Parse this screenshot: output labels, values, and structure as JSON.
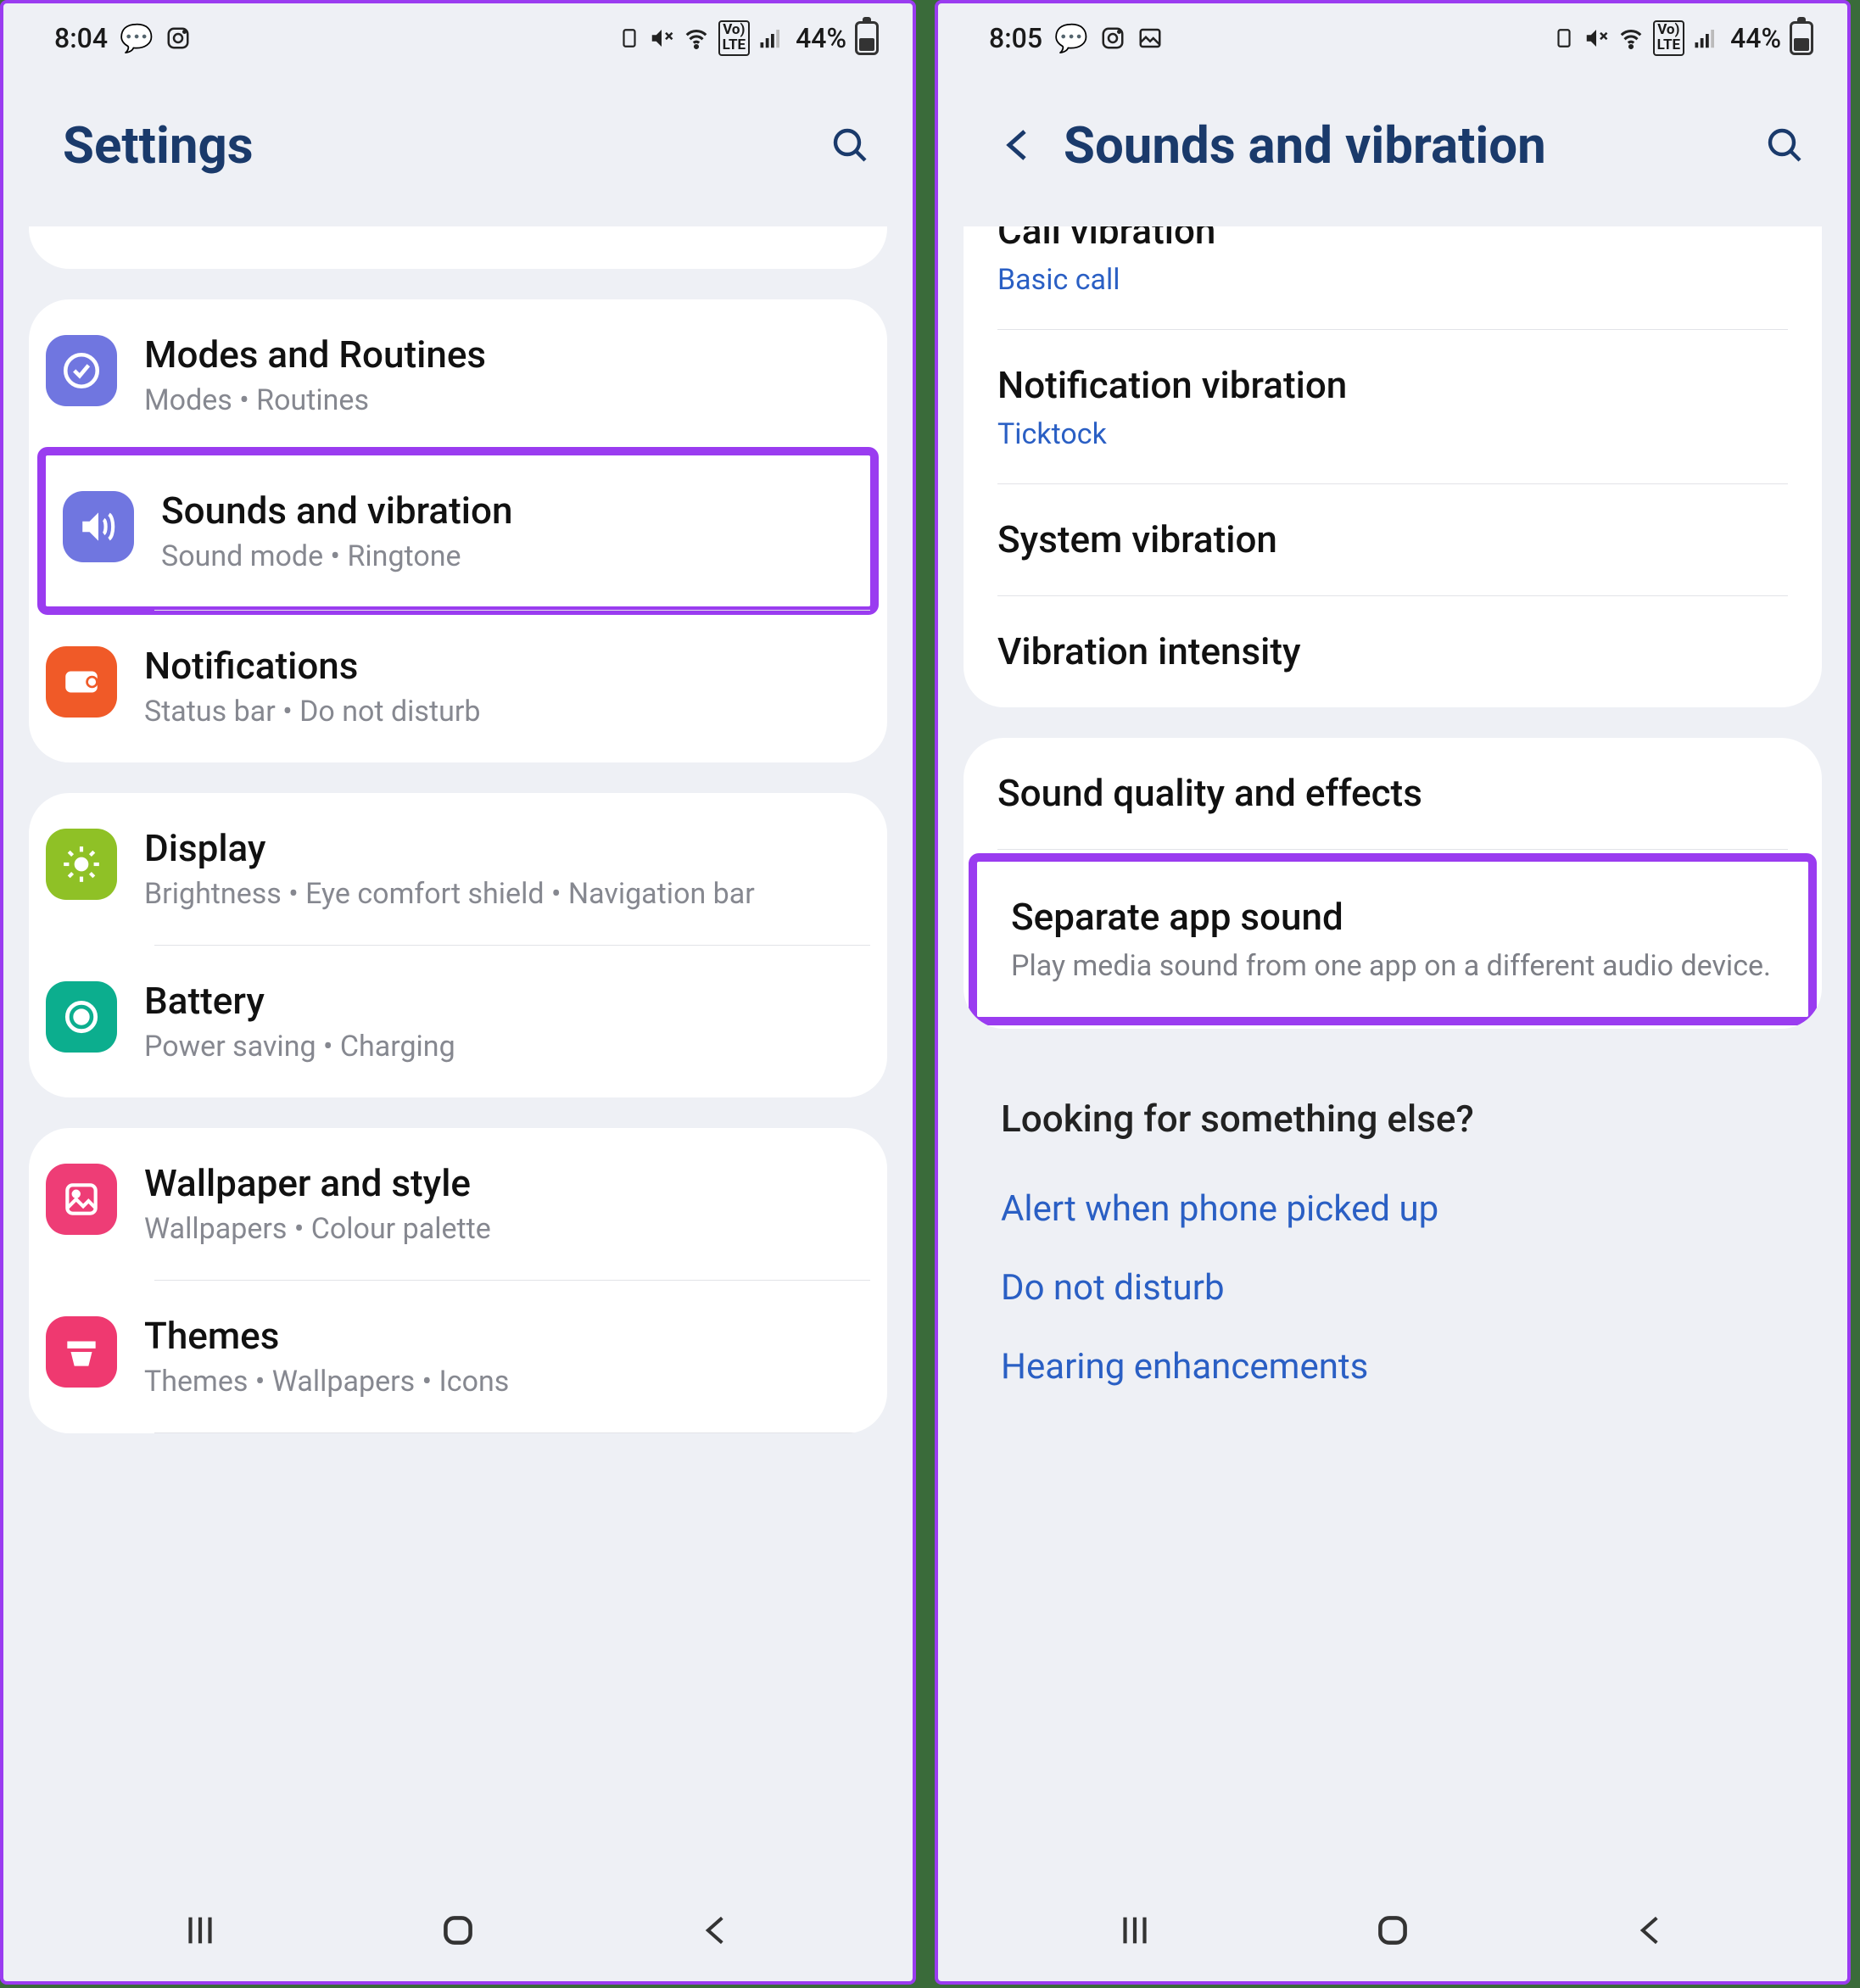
{
  "left": {
    "status": {
      "time": "8:04",
      "battery": "44%"
    },
    "header": {
      "title": "Settings"
    },
    "partial_top_text": "",
    "groups": [
      {
        "items": [
          {
            "icon": "modes-routines-icon",
            "iconClass": "ic-purple",
            "title": "Modes and Routines",
            "sub": "Modes  •  Routines"
          },
          {
            "icon": "sound-icon",
            "iconClass": "ic-purple",
            "title": "Sounds and vibration",
            "sub": "Sound mode  •  Ringtone",
            "highlight": true
          },
          {
            "icon": "notifications-icon",
            "iconClass": "ic-orange",
            "title": "Notifications",
            "sub": "Status bar  •  Do not disturb"
          }
        ]
      },
      {
        "items": [
          {
            "icon": "display-icon",
            "iconClass": "ic-green",
            "title": "Display",
            "sub": "Brightness  •  Eye comfort shield  •  Navigation bar"
          },
          {
            "icon": "battery-icon",
            "iconClass": "ic-teal",
            "title": "Battery",
            "sub": "Power saving  •  Charging"
          }
        ]
      },
      {
        "items": [
          {
            "icon": "wallpaper-icon",
            "iconClass": "ic-pink",
            "title": "Wallpaper and style",
            "sub": "Wallpapers  •  Colour palette"
          },
          {
            "icon": "themes-icon",
            "iconClass": "ic-pink2",
            "title": "Themes",
            "sub": "Themes  •  Wallpapers  •  Icons"
          }
        ]
      }
    ]
  },
  "right": {
    "status": {
      "time": "8:05",
      "battery": "44%"
    },
    "header": {
      "title": "Sounds and vibration"
    },
    "groups": [
      {
        "partial": true,
        "items": [
          {
            "title": "Call vibration",
            "link": "Basic call",
            "cut": true
          },
          {
            "title": "Notification vibration",
            "link": "Ticktock"
          },
          {
            "title": "System vibration"
          },
          {
            "title": "Vibration intensity"
          }
        ]
      },
      {
        "items": [
          {
            "title": "Sound quality and effects"
          },
          {
            "title": "Separate app sound",
            "desc": "Play media sound from one app on a different audio device.",
            "highlight": true
          }
        ]
      }
    ],
    "looking": {
      "title": "Looking for something else?",
      "links": [
        "Alert when phone picked up",
        "Do not disturb",
        "Hearing enhancements"
      ]
    }
  }
}
